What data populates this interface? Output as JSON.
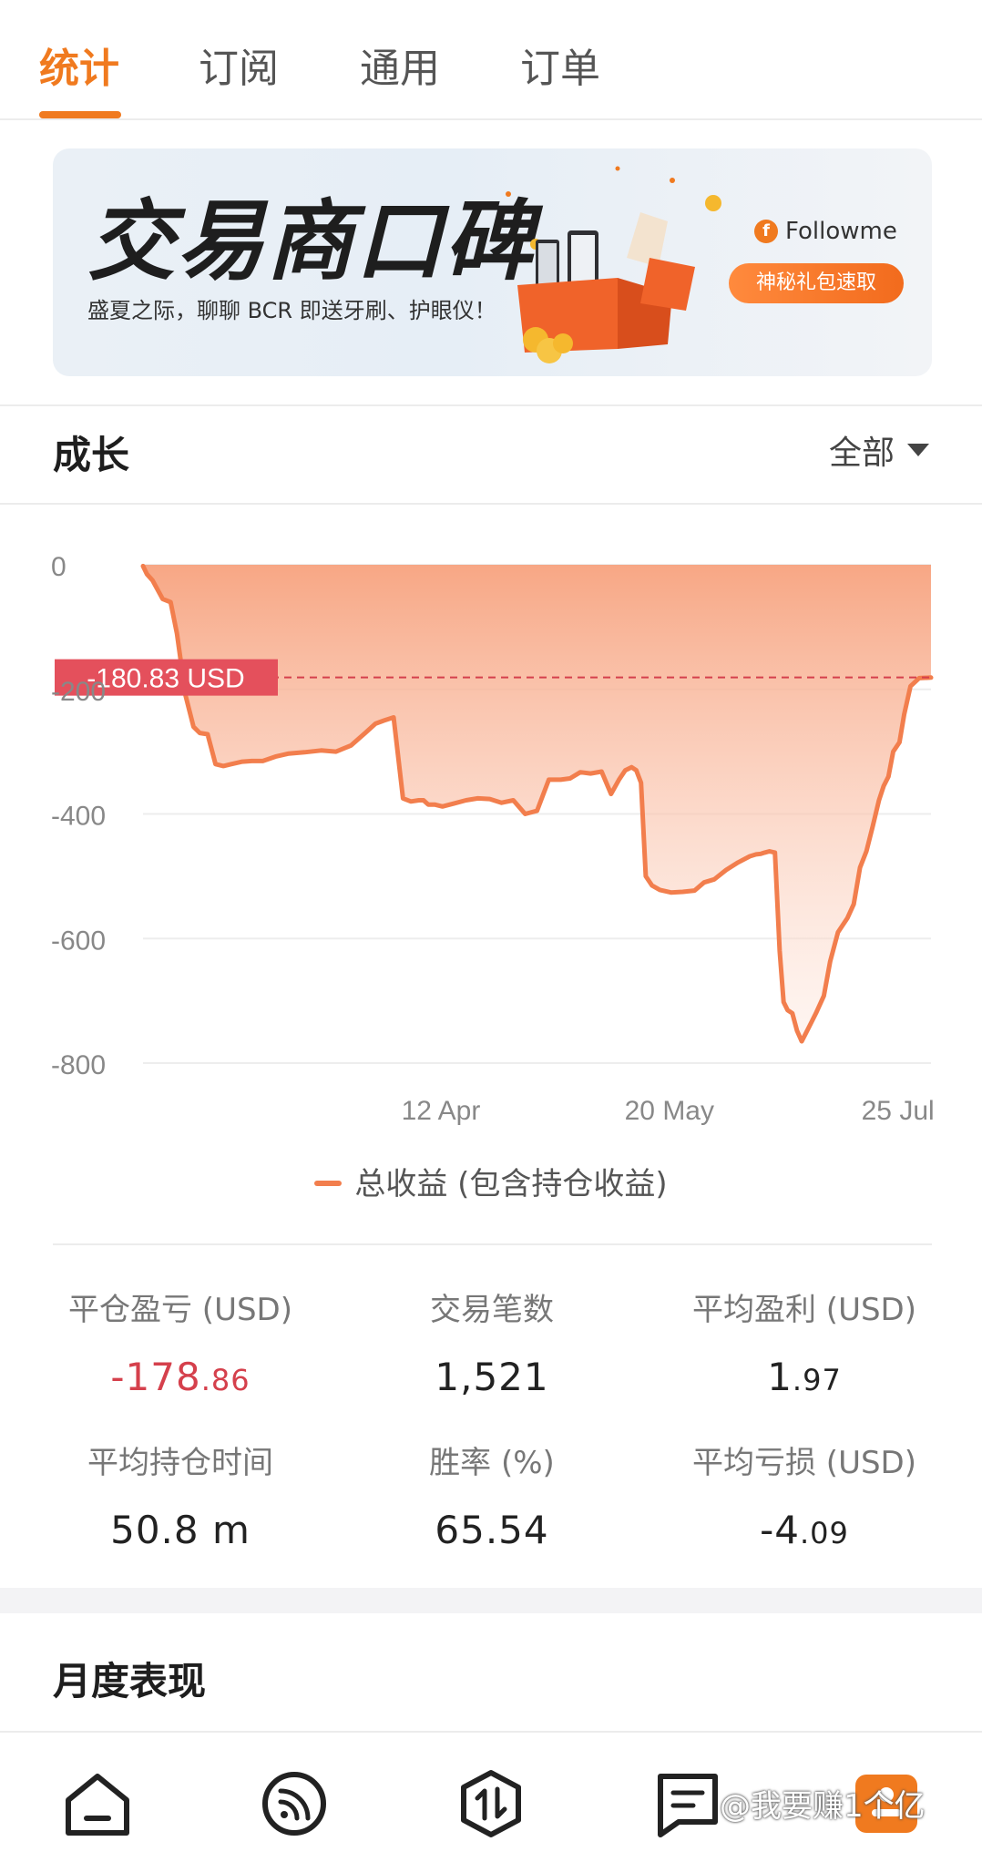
{
  "tabs": [
    {
      "label": "统计",
      "active": true
    },
    {
      "label": "订阅",
      "active": false
    },
    {
      "label": "通用",
      "active": false
    },
    {
      "label": "订单",
      "active": false
    }
  ],
  "banner": {
    "title": "交易商口碑",
    "subtitle": "盛夏之际，聊聊 BCR 即送牙刷、护眼仪！",
    "brand": "Followme",
    "button": "神秘礼包速取"
  },
  "growth": {
    "title": "成长",
    "filter": "全部",
    "marker_label": "-180.83 USD",
    "legend": "总收益 (包含持仓收益)"
  },
  "chart_data": {
    "type": "area",
    "ylim": [
      -800,
      0
    ],
    "ytick_labels": [
      "0",
      "-200",
      "-400",
      "-600",
      "-800"
    ],
    "yticks": [
      0,
      -200,
      -400,
      -600,
      -800
    ],
    "xtick_labels": [
      "12 Apr",
      "20 May",
      "25 Jul"
    ],
    "xlim": [
      0,
      100
    ],
    "xticks": [
      37.8,
      66.8,
      95.8
    ],
    "reference_value": -180.83,
    "series": [
      {
        "name": "总收益 (包含持仓收益)",
        "color": "#f27e4d",
        "x": [
          0,
          0.5,
          1.2,
          2.5,
          3.5,
          4.3,
          4.8,
          5.2,
          5.8,
          6.4,
          7.2,
          8.2,
          9.2,
          10.2,
          11.2,
          12.6,
          13.8,
          15.2,
          16.8,
          18.5,
          20.5,
          22.6,
          24.5,
          26.4,
          28.2,
          29.5,
          30.6,
          31.8,
          33.0,
          34.0,
          35.0,
          35.6,
          36.2,
          37.0,
          38.0,
          39.5,
          41.0,
          42.5,
          44.0,
          45.5,
          47.0,
          48.5,
          50.0,
          51.5,
          53.0,
          54.2,
          55.5,
          56.8,
          58.2,
          59.4,
          60.4,
          61.2,
          62.0,
          62.6,
          63.2,
          63.8,
          64.6,
          65.6,
          67.0,
          68.5,
          70.0,
          71.2,
          72.5,
          74.0,
          75.5,
          77.0,
          77.8,
          78.4,
          78.9,
          79.5,
          80.2,
          80.8,
          81.3,
          81.8,
          82.4,
          83.0,
          83.6,
          84.4,
          85.4,
          86.4,
          87.2,
          88.2,
          89.4,
          90.2,
          91.0,
          91.8,
          92.6,
          93.4,
          94.0,
          94.6,
          95.2,
          96.0,
          96.6,
          97.4,
          98.5,
          100.0
        ],
        "values": [
          -2,
          -15,
          -25,
          -55,
          -60,
          -110,
          -155,
          -200,
          -230,
          -260,
          -270,
          -272,
          -320,
          -323,
          -320,
          -316,
          -315,
          -315,
          -308,
          -303,
          -301,
          -298,
          -300,
          -290,
          -270,
          -255,
          -250,
          -245,
          -375,
          -380,
          -378,
          -378,
          -385,
          -385,
          -388,
          -383,
          -378,
          -375,
          -376,
          -382,
          -378,
          -400,
          -395,
          -345,
          -345,
          -343,
          -333,
          -335,
          -332,
          -368,
          -345,
          -330,
          -325,
          -330,
          -350,
          -500,
          -515,
          -522,
          -526,
          -525,
          -523,
          -510,
          -505,
          -490,
          -478,
          -468,
          -465,
          -464,
          -462,
          -460,
          -462,
          -620,
          -702,
          -715,
          -720,
          -748,
          -765,
          -745,
          -720,
          -692,
          -637,
          -590,
          -567,
          -545,
          -486,
          -460,
          -420,
          -378,
          -355,
          -340,
          -300,
          -285,
          -240,
          -195,
          -182,
          -181
        ]
      }
    ]
  },
  "stats": [
    {
      "label": "平仓盈亏 (USD)",
      "int": "-178",
      "dec": ".86",
      "negative": true
    },
    {
      "label": "交易笔数",
      "int": "1,521",
      "dec": "",
      "negative": false
    },
    {
      "label": "平均盈利 (USD)",
      "int": "1",
      "dec": ".97",
      "negative": false
    },
    {
      "label": "平均持仓时间",
      "int": "50.8 m",
      "dec": "",
      "negative": false
    },
    {
      "label": "胜率 (%)",
      "int": "65.54",
      "dec": "",
      "negative": false
    },
    {
      "label": "平均亏损 (USD)",
      "int": "-4",
      "dec": ".09",
      "negative": false
    }
  ],
  "monthly": {
    "title": "月度表现"
  },
  "bottom_nav": [
    {
      "icon": "home-icon"
    },
    {
      "icon": "feed-icon"
    },
    {
      "icon": "trade-icon"
    },
    {
      "icon": "list-icon"
    },
    {
      "icon": "profile-icon"
    }
  ],
  "watermark": "@我要赚1个亿"
}
